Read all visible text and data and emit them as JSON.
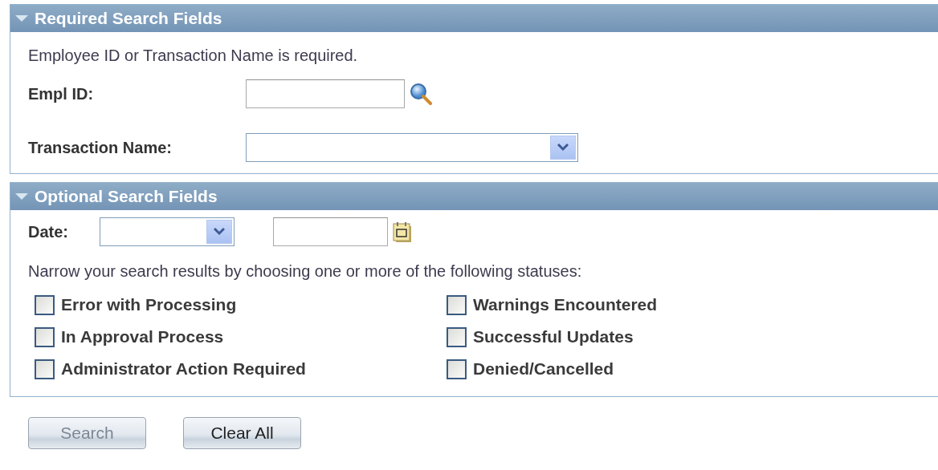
{
  "sections": [
    {
      "kind": "required",
      "title": "Required Search Fields",
      "expanded": true,
      "instruction": "Employee ID or Transaction Name is required.",
      "fields": [
        {
          "kind": "lookup",
          "label": "Empl ID:"
        },
        {
          "kind": "dropdown",
          "label": "Transaction Name:"
        }
      ]
    },
    {
      "kind": "optional",
      "title": "Optional Search Fields",
      "expanded": true,
      "date": {
        "label": "Date:"
      },
      "instruction": "Narrow your search results by choosing one or more of the following statuses:",
      "statuses": [
        {
          "label": "Error with Processing",
          "checked": false
        },
        {
          "label": "Warnings Encountered",
          "checked": false
        },
        {
          "label": "In Approval Process",
          "checked": false
        },
        {
          "label": "Successful Updates",
          "checked": false
        },
        {
          "label": "Administrator Action Required",
          "checked": false
        },
        {
          "label": "Denied/Cancelled",
          "checked": false
        }
      ]
    }
  ],
  "buttons": [
    {
      "label": "Search",
      "disabled": true
    },
    {
      "label": "Clear All",
      "disabled": false
    }
  ]
}
